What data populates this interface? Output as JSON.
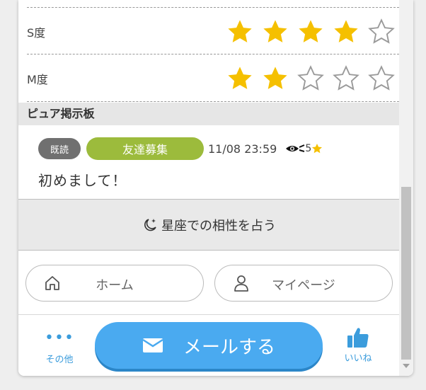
{
  "ratings": [
    {
      "label": "S度",
      "value": 4,
      "max": 5
    },
    {
      "label": "M度",
      "value": 2,
      "max": 5
    }
  ],
  "colors": {
    "star_filled": "#f5c000",
    "star_empty_stroke": "#9a9a9a",
    "accent": "#4aaaf0",
    "category": "#9cbb3c"
  },
  "board": {
    "title": "ピュア掲示板"
  },
  "post": {
    "read_badge": "既読",
    "category": "友達募集",
    "time": "11/08 23:59",
    "views": "5",
    "body": "初めまして！"
  },
  "horoscope": {
    "label": "星座での相性を占う"
  },
  "nav": {
    "home_label": "ホーム",
    "mypage_label": "マイページ"
  },
  "bottom": {
    "other_label": "その他",
    "mail_label": "メールする",
    "like_label": "いいね"
  }
}
